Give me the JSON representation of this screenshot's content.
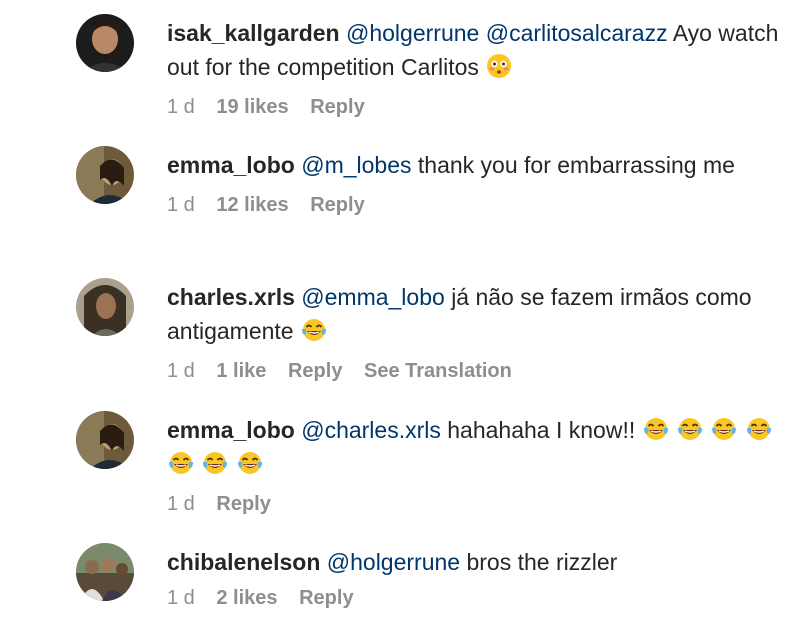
{
  "comments": [
    {
      "username": "isak_kallgarden",
      "mentions": [
        "@holgerrune",
        "@carlitosalcarazz"
      ],
      "text": "Ayo watch out for the competition Carlitos",
      "emoji": [
        "flushed-face"
      ],
      "time": "1 d",
      "likes": "19 likes",
      "reply": "Reply"
    },
    {
      "username": "emma_lobo",
      "mentions": [
        "@m_lobes"
      ],
      "text": "thank you for embarrassing me",
      "emoji": [],
      "time": "1 d",
      "likes": "12 likes",
      "reply": "Reply"
    },
    {
      "username": "charles.xrls",
      "mentions": [
        "@emma_lobo"
      ],
      "text": "já não se fazem irmãos como antigamente",
      "emoji": [
        "tears-of-joy"
      ],
      "time": "1 d",
      "likes": "1 like",
      "reply": "Reply",
      "translate": "See Translation"
    },
    {
      "username": "emma_lobo",
      "mentions": [
        "@charles.xrls"
      ],
      "text": "hahahaha I know!!",
      "emoji": [
        "tears-of-joy",
        "tears-of-joy",
        "tears-of-joy",
        "tears-of-joy",
        "tears-of-joy",
        "tears-of-joy",
        "tears-of-joy"
      ],
      "time": "1 d",
      "reply": "Reply"
    },
    {
      "username": "chibalenelson",
      "mentions": [
        "@holgerrune"
      ],
      "text": "bros the rizzler",
      "emoji": [],
      "time": "1 d",
      "likes": "2 likes",
      "reply": "Reply"
    }
  ],
  "colors": {
    "text": "#262626",
    "mention": "#00376b",
    "meta": "#8e8e8e",
    "emoji_face": "#f9c623"
  }
}
